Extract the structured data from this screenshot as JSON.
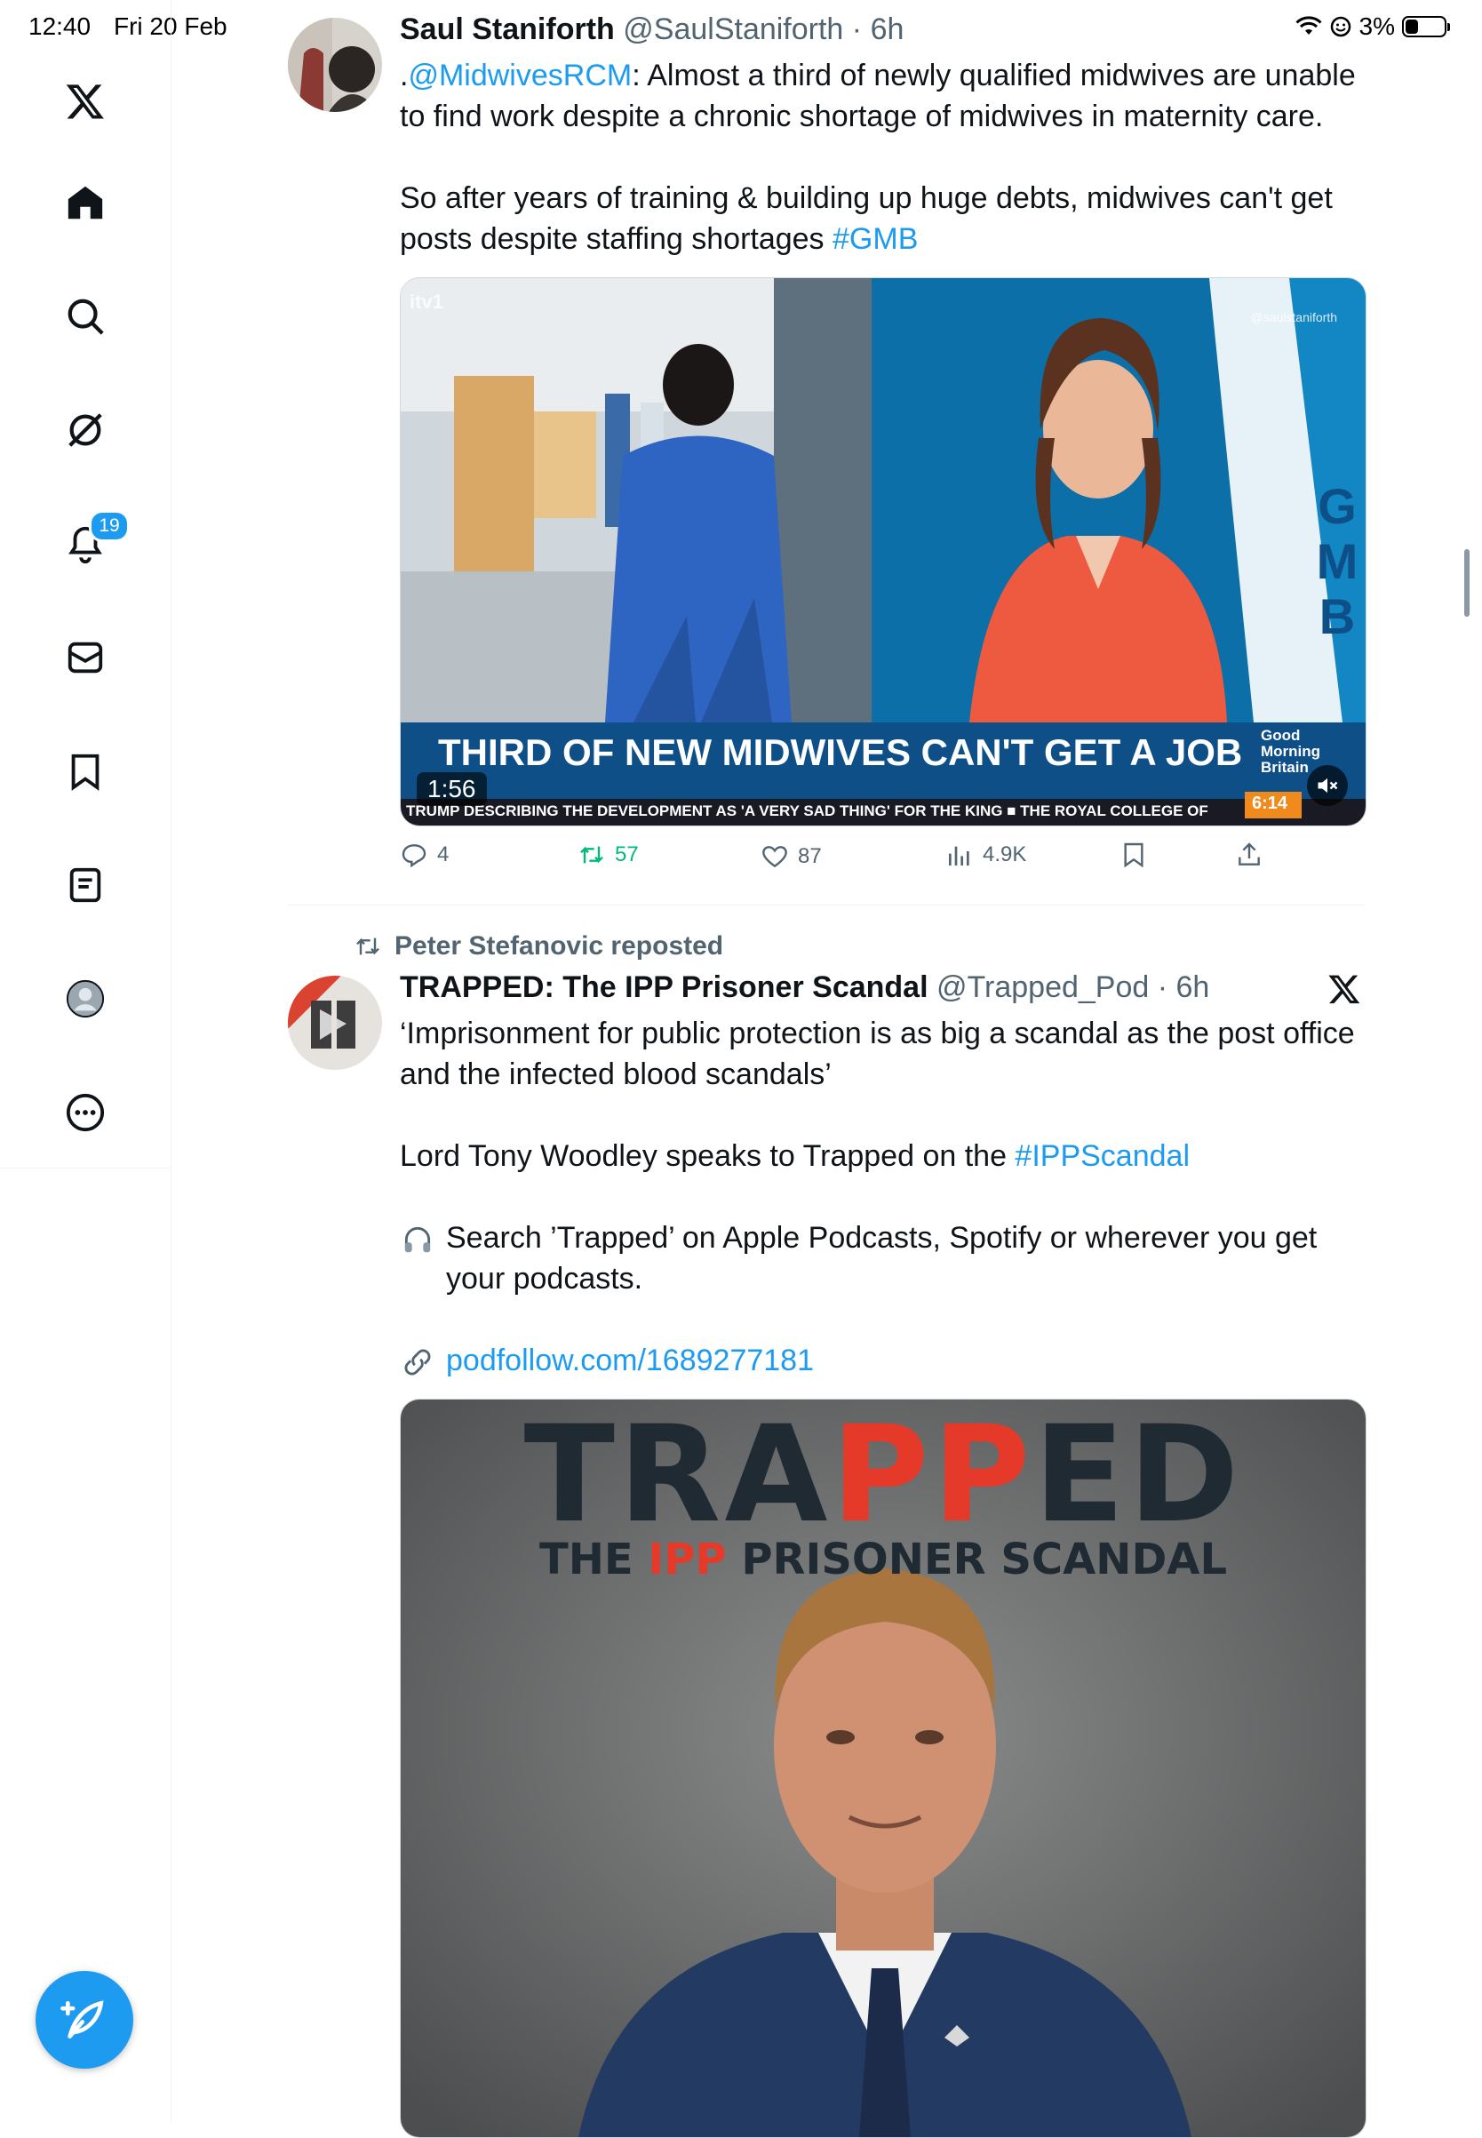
{
  "status_bar": {
    "time": "12:40",
    "date": "Fri 20 Feb",
    "battery": "3%"
  },
  "colors": {
    "accent": "#1d9bf0",
    "repost_green": "#00ba7c",
    "text_secondary": "#536471"
  },
  "sidebar": {
    "items": [
      {
        "name": "x-logo",
        "icon": "x-logo-icon"
      },
      {
        "name": "home",
        "icon": "home-icon"
      },
      {
        "name": "search",
        "icon": "search-icon"
      },
      {
        "name": "grok",
        "icon": "grok-icon"
      },
      {
        "name": "notifications",
        "icon": "bell-icon",
        "badge": "19"
      },
      {
        "name": "messages",
        "icon": "mail-icon"
      },
      {
        "name": "bookmarks",
        "icon": "bookmark-icon"
      },
      {
        "name": "lists",
        "icon": "list-icon"
      },
      {
        "name": "profile",
        "icon": "profile-icon"
      },
      {
        "name": "more",
        "icon": "more-icon"
      }
    ],
    "compose_icon": "compose-icon"
  },
  "tweets": [
    {
      "author": "Saul Staniforth",
      "handle": "@SaulStaniforth",
      "time": "· 6h",
      "text_mention": "@MidwivesRCM",
      "text_prefix": ".",
      "text_line1": ": Almost a third of newly qualified midwives are unable to find work despite a chronic shortage of midwives in maternity care.",
      "text_line2": "So after years of training & building up huge debts, midwives can't get posts despite staffing shortages ",
      "hashtag": "#GMB",
      "video": {
        "duration": "1:56",
        "headline": "THIRD OF NEW MIDWIVES CAN'T GET A JOB",
        "ticker": "TRUMP DESCRIBING THE DEVELOPMENT AS 'A VERY SAD THING' FOR THE KING  ■  THE ROYAL COLLEGE OF",
        "clock": "6:14",
        "channel": "itv1",
        "watermark": "@saulstaniforth",
        "brand_lines": [
          "Good",
          "Morning",
          "Britain"
        ],
        "side_letters": [
          "G",
          "M",
          "B"
        ]
      },
      "stats": {
        "replies": "4",
        "reposts": "57",
        "likes": "87",
        "views": "4.9K"
      }
    },
    {
      "repost_by": "Peter Stefanovic reposted",
      "author": "TRAPPED: The IPP Prisoner Scandal",
      "handle": "@Trapped_Pod",
      "time": "· 6h",
      "text_line1": "‘Imprisonment for public protection is as big a scandal as the post office and the infected blood scandals’",
      "text_line2": "Lord Tony Woodley speaks to Trapped on the ",
      "hashtag": "#IPPScandal",
      "text_line3": "Search ’Trapped’ on Apple Podcasts, Spotify or wherever you get your podcasts.",
      "link": "podfollow.com/1689277181",
      "media": {
        "title_a": "TRA",
        "title_b": "PP",
        "title_c": "ED",
        "subtitle_a": "THE ",
        "subtitle_b": "IPP",
        "subtitle_c": " PRISONER SCANDAL"
      }
    }
  ]
}
